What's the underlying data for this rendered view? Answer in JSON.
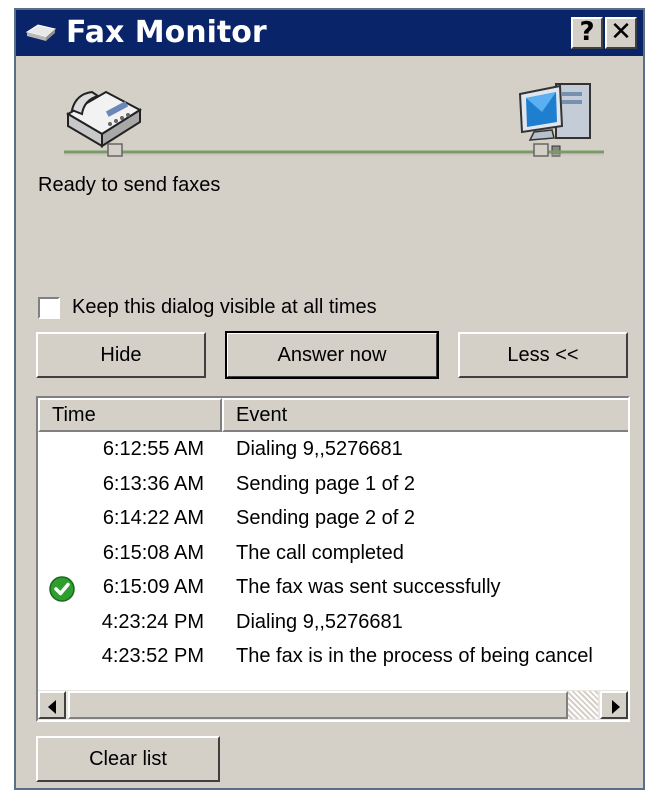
{
  "window": {
    "title": "Fax Monitor",
    "help_label": "?",
    "close_label": "✕"
  },
  "status": {
    "text": "Ready to send faxes"
  },
  "options": {
    "keep_visible_label": "Keep this dialog visible at all times",
    "keep_visible_checked": false
  },
  "buttons": {
    "hide": "Hide",
    "answer_now": "Answer now",
    "less": "Less <<",
    "clear_list": "Clear list"
  },
  "list": {
    "columns": [
      "Time",
      "Event"
    ],
    "rows": [
      {
        "time": "6:12:55 AM",
        "event": "Dialing 9,,5276681",
        "icon": ""
      },
      {
        "time": "6:13:36 AM",
        "event": "Sending page 1 of 2",
        "icon": ""
      },
      {
        "time": "6:14:22 AM",
        "event": "Sending page 2 of 2",
        "icon": ""
      },
      {
        "time": "6:15:08 AM",
        "event": "The call completed",
        "icon": ""
      },
      {
        "time": "6:15:09 AM",
        "event": "The fax was sent successfully",
        "icon": "success-check-icon"
      },
      {
        "time": "4:23:24 PM",
        "event": "Dialing 9,,5276681",
        "icon": ""
      },
      {
        "time": "4:23:52 PM",
        "event": "The fax is in the process of being cancel",
        "icon": ""
      }
    ]
  },
  "icons": {
    "title": "fax-machine-icon",
    "device": "fax-machine-icon",
    "computer": "computer-icon",
    "connection": "connection-line-icon"
  },
  "colors": {
    "titlebar": "#0a246a",
    "dialog_face": "#d4d0c8",
    "line_green": "#7a9a6a",
    "success_green": "#2e9e2e"
  }
}
